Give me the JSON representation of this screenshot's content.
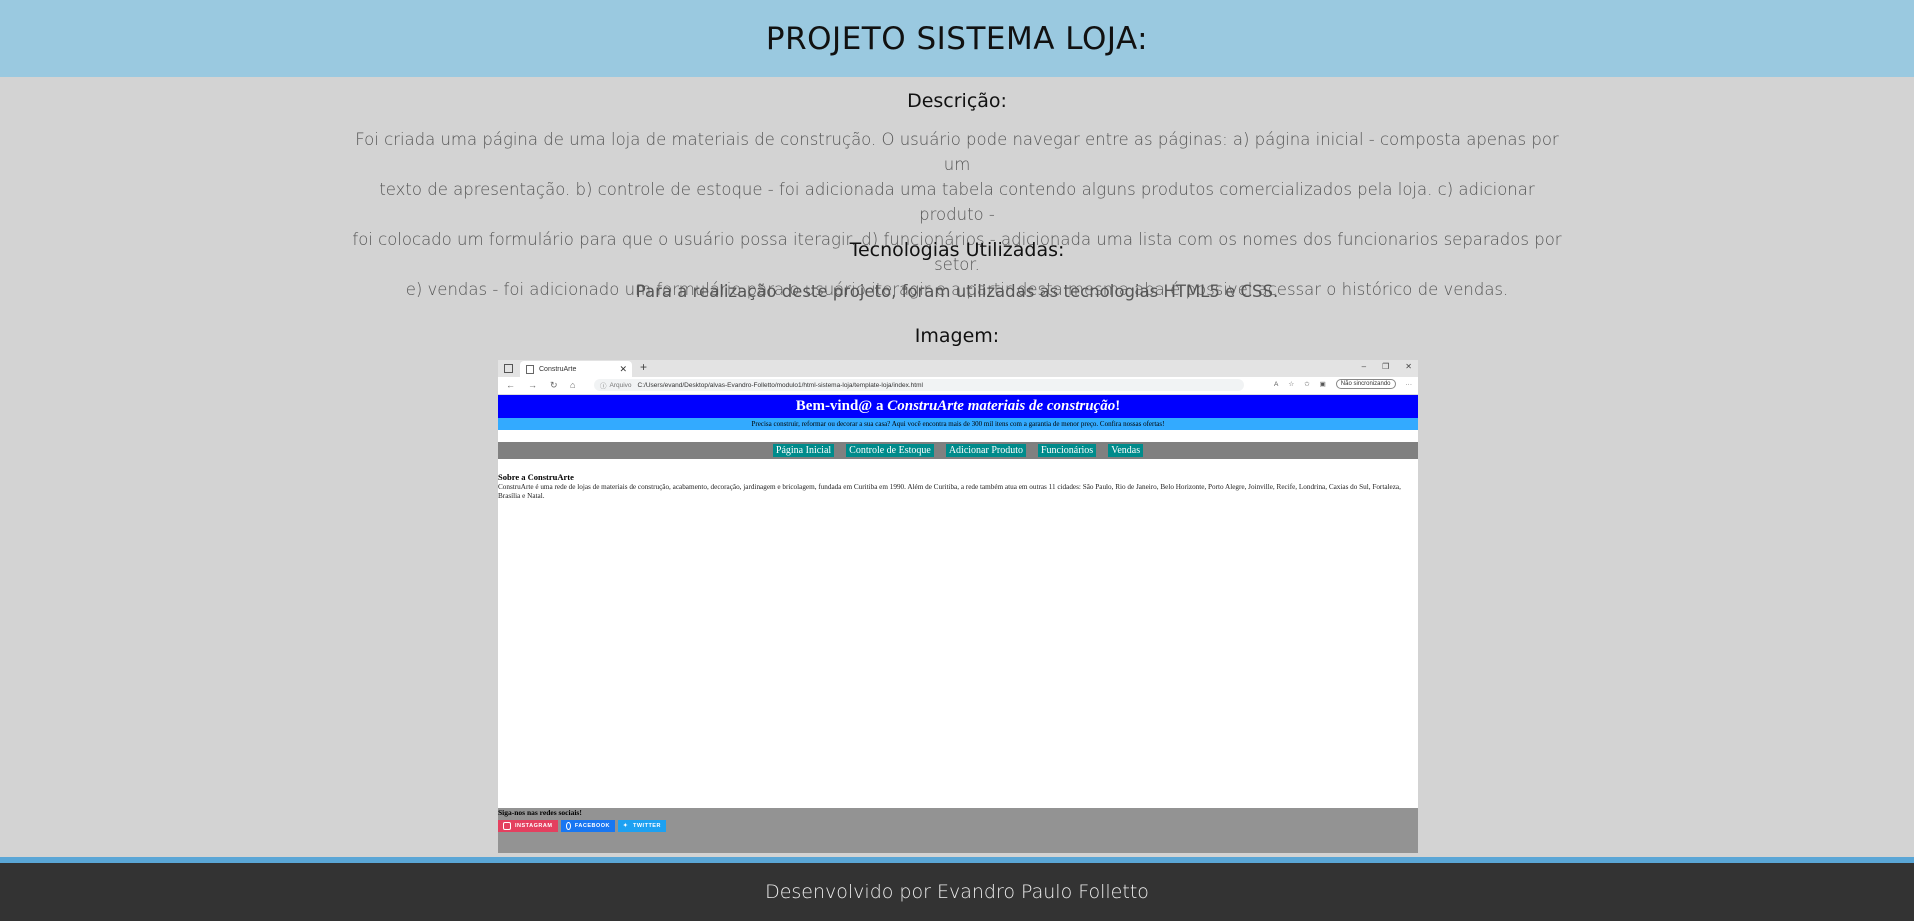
{
  "header": {
    "title": "PROJETO SISTEMA LOJA:"
  },
  "main": {
    "desc_title": "Descrição:",
    "desc_lines": [
      "Foi criada uma página de uma loja de materiais de construção. O usuário pode navegar entre as páginas: a) página inicial - composta apenas por um",
      "texto de apresentação. b) controle de estoque - foi adicionada uma tabela contendo alguns produtos comercializados pela loja. c) adicionar produto -",
      "foi colocado um formulário para que o usuário possa iteragir. d) funcionários - adicionada uma lista com os nomes dos funcionarios separados por setor.",
      "e) vendas - foi adicionado um formulário para o usuário iteragir e a partir desta mesma aba é possivel acessar o histórico de vendas."
    ],
    "tech_title": "Tecnologias Utilizadas:",
    "tech_text": "Para a realização deste projeto, foram utilizadas as tecnologias HTML5 e CSS.",
    "image_title": "Imagem:"
  },
  "screenshot": {
    "tab_title": "ConstruArte",
    "address_label": "Arquivo",
    "url": "C:/Users/evand/Desktop/alvas-Evandro-Folletto/modulo1/html-sistema-loja/template-loja/index.html",
    "sync_label": "Não sincronizando",
    "heading_prefix": "Bem-vind@ a ",
    "heading_brand": "ConstruArte materiais de construção",
    "heading_suffix": "!",
    "subtitle": "Precisa construir, reformar ou decorar a sua casa? Aqui você encontra mais de 300 mil itens com a garantia de menor preço. Confira nossas ofertas!",
    "nav": [
      "Página Inicial",
      "Controle de Estoque",
      "Adicionar Produto",
      "Funcionários",
      "Vendas"
    ],
    "about_title": "Sobre a ConstruArte",
    "about_text": "ConstruArte é uma rede de lojas de materiais de construção, acabamento, decoração, jardinagem e bricolagem, fundada em Curitiba em 1990. Além de Curitiba, a rede também atua em outras 11 cidades: São Paulo, Rio de Janeiro, Belo Horizonte, Porto Alegre, Joinville, Recife, Londrina, Caxias do Sul, Fortaleza, Brasília e Natal.",
    "follow": "Siga-nos nas redes sociais!",
    "socials": [
      "INSTAGRAM",
      "FACEBOOK",
      "TWITTER"
    ]
  },
  "footer": {
    "text": "Desenvolvido por Evandro Paulo Folletto"
  }
}
